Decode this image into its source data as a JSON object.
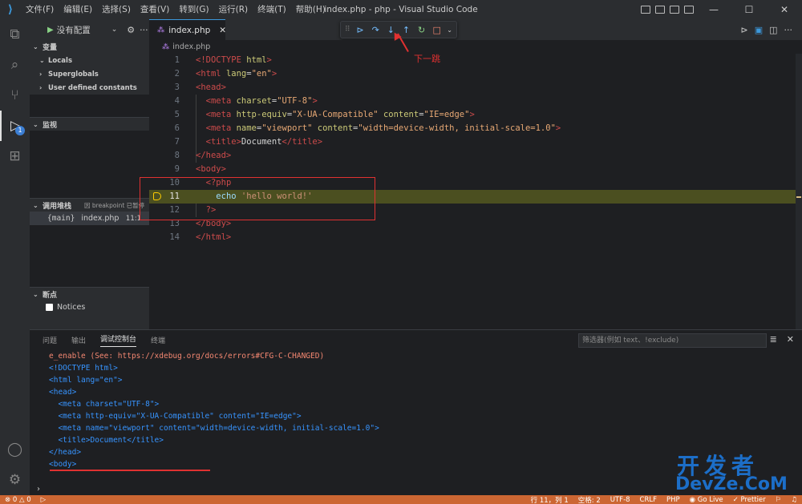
{
  "titlebar": {
    "menu": [
      "文件(F)",
      "编辑(E)",
      "选择(S)",
      "查看(V)",
      "转到(G)",
      "运行(R)",
      "终端(T)",
      "帮助(H)"
    ],
    "title": "index.php - php - Visual Studio Code"
  },
  "sidebar": {
    "run_config": "没有配置",
    "variables_title": "变量",
    "variables": [
      "Locals",
      "Superglobals",
      "User defined constants"
    ],
    "watch_title": "监视",
    "callstack_title": "调用堆栈",
    "callstack_status": "因 breakpoint 已暂停",
    "callstack_frame": {
      "name": "{main}",
      "file": "index.php",
      "pos": "11:1"
    },
    "breakpoints_title": "断点",
    "breakpoint_item": "Notices"
  },
  "editor": {
    "tab_label": "index.php",
    "breadcrumb": "index.php",
    "annotation": "下一跳",
    "current_line": 11
  },
  "panel": {
    "tabs": [
      "问题",
      "输出",
      "调试控制台",
      "终端"
    ],
    "active_tab": "调试控制台",
    "filter_placeholder": "筛选器(例如 text、!exclude)",
    "error_line": "e_enable (See: https://xdebug.org/docs/errors#CFG-C-CHANGED)"
  },
  "statusbar": {
    "errors": "0",
    "warnings": "0",
    "position": "行 11，列 1",
    "spaces": "空格: 2",
    "encoding": "UTF-8",
    "eol": "CRLF",
    "language": "PHP",
    "golive": "Go Live",
    "prettier": "Prettier"
  },
  "watermark": {
    "cn": "开发者",
    "en": "DevZe.CoM"
  },
  "colors": {
    "accent": "#3c99dc",
    "statusbar": "#cc6633",
    "annotation": "#e03131",
    "current_line": "#4b4f20"
  }
}
